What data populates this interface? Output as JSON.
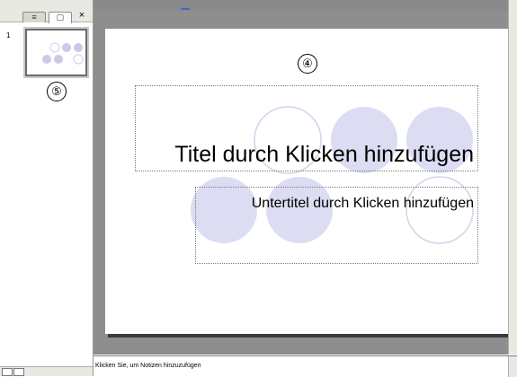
{
  "sidebar": {
    "tabs": [
      {
        "name": "outline",
        "glyph": "≡"
      },
      {
        "name": "slides",
        "glyph": "▢"
      }
    ],
    "close_glyph": "×",
    "thumbnail": {
      "number": "1"
    },
    "callout": "⑤"
  },
  "slide": {
    "callout": "④",
    "title_placeholder": "Titel durch Klicken hinzufügen",
    "subtitle_placeholder": "Untertitel durch Klicken hinzufügen"
  },
  "notes": {
    "placeholder": "Klicken Sie, um Notizen hinzuzufügen"
  },
  "colors": {
    "circle_fill": "#dcdcf2",
    "circle_stroke": "#d2d2ea",
    "canvas_bg": "#8e8e8e"
  }
}
